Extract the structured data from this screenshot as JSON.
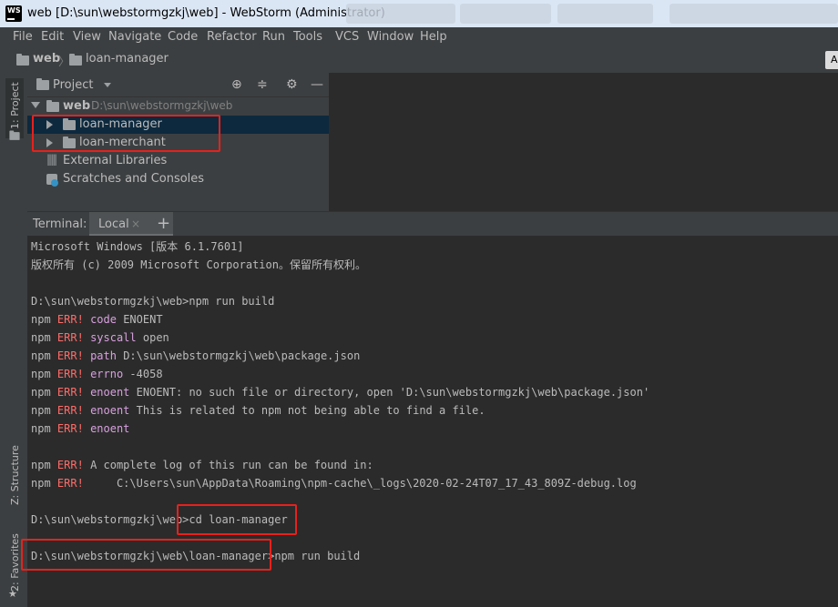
{
  "window": {
    "title": "web [D:\\sun\\webstormgzkj\\web] - WebStorm (Administrator)",
    "app_icon": "WS"
  },
  "menu": [
    "File",
    "Edit",
    "View",
    "Navigate",
    "Code",
    "Refactor",
    "Run",
    "Tools",
    "VCS",
    "Window",
    "Help"
  ],
  "breadcrumb": {
    "root": "web",
    "child": "loan-manager",
    "edge_button": "A"
  },
  "left_strip": {
    "project_tab": "1: Project",
    "structure_tab": "Z: Structure",
    "favorites_tab": "2: Favorites"
  },
  "project": {
    "header": "Project",
    "root_name": "web",
    "root_path": "D:\\sun\\webstormgzkj\\web",
    "items": [
      "loan-manager",
      "loan-merchant"
    ],
    "external_libraries": "External Libraries",
    "scratches": "Scratches and Consoles"
  },
  "terminal": {
    "label": "Terminal:",
    "tab": "Local",
    "add_tab": "+",
    "lines": {
      "l1": "Microsoft Windows [版本 6.1.7601]",
      "l2": "版权所有 (c) 2009 Microsoft Corporation。保留所有权利。",
      "prompt1": "D:\\sun\\webstormgzkj\\web>",
      "cmd1": "npm run build",
      "npm": "npm",
      "err": "ERR!",
      "e1_key": "code",
      "e1_val": "ENOENT",
      "e2_key": "syscall",
      "e2_val": "open",
      "e3_key": "path",
      "e3_val": "D:\\sun\\webstormgzkj\\web\\package.json",
      "e4_key": "errno",
      "e4_val": "-4058",
      "e5_key": "enoent",
      "e5_val": "ENOENT: no such file or directory, open 'D:\\sun\\webstormgzkj\\web\\package.json'",
      "e6_key": "enoent",
      "e6_val": "This is related to npm not being able to find a file.",
      "e7_key": "enoent",
      "e8_val": "A complete log of this run can be found in:",
      "e9_val": "    C:\\Users\\sun\\AppData\\Roaming\\npm-cache\\_logs\\2020-02-24T07_17_43_809Z-debug.log",
      "prompt2": "D:\\sun\\webstormgzkj\\web>",
      "cmd2": "cd loan-manager",
      "prompt3": "D:\\sun\\webstormgzkj\\web\\loan-manager>",
      "cmd3": "npm run build"
    }
  },
  "colors": {
    "error": "#ff6b68",
    "keyword": "#d8a0df",
    "highlight_box": "#e8211c",
    "selection": "#0d293e"
  }
}
